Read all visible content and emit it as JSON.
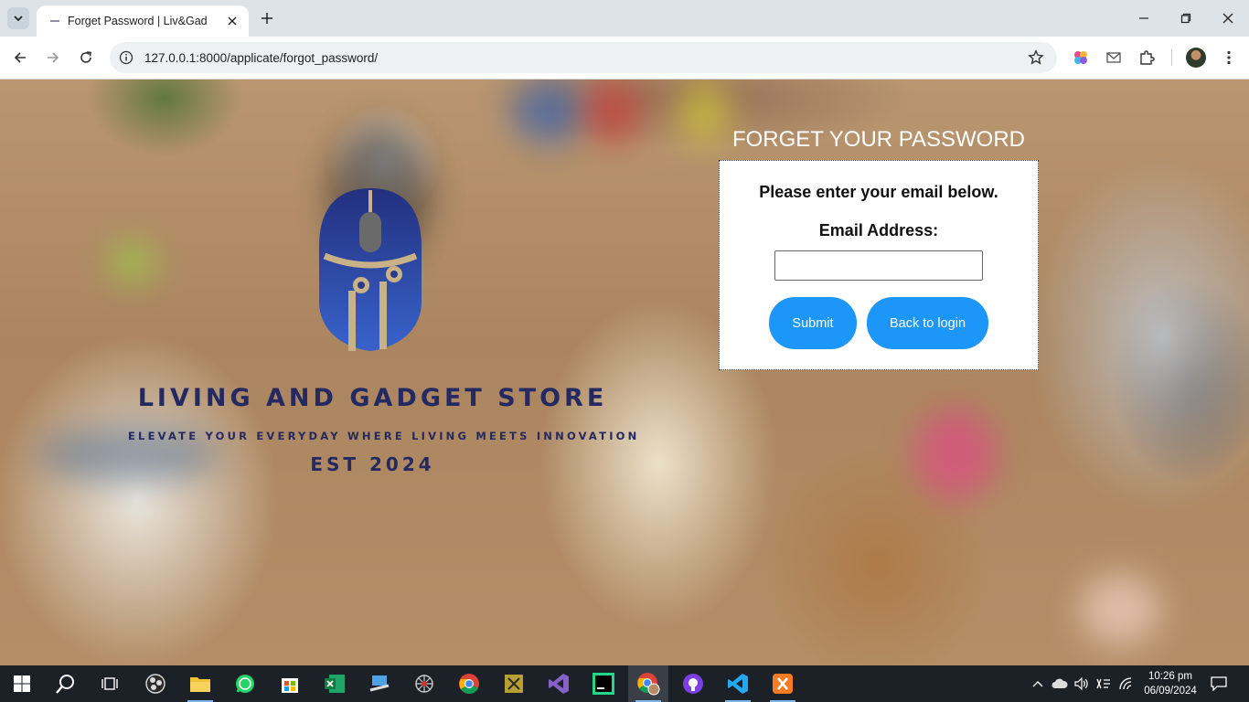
{
  "browser": {
    "tab_title": "Forget Password | Liv&Gad",
    "url": "127.0.0.1:8000/applicate/forgot_password/"
  },
  "page": {
    "brand_name": "LIVING AND GADGET STORE",
    "tagline": "ELEVATE YOUR EVERYDAY WHERE LIVING MEETS INNOVATION",
    "est": "EST 2024",
    "heading": "FORGET YOUR PASSWORD",
    "instruction": "Please enter your email below.",
    "email_label": "Email Address:",
    "email_value": "",
    "submit_label": "Submit",
    "back_label": "Back to login"
  },
  "taskbar": {
    "time": "10:26 pm",
    "date": "06/09/2024",
    "apps": [
      "start",
      "search",
      "task-view",
      "obs",
      "file-explorer",
      "whatsapp",
      "store",
      "excel",
      "network-tool",
      "spider",
      "chrome",
      "tool",
      "visual-studio",
      "pycharm",
      "chrome-profile",
      "github",
      "vscode",
      "xampp"
    ]
  },
  "colors": {
    "accent": "#2196f3",
    "brand_navy": "#25295e",
    "taskbar": "#1c2027"
  }
}
